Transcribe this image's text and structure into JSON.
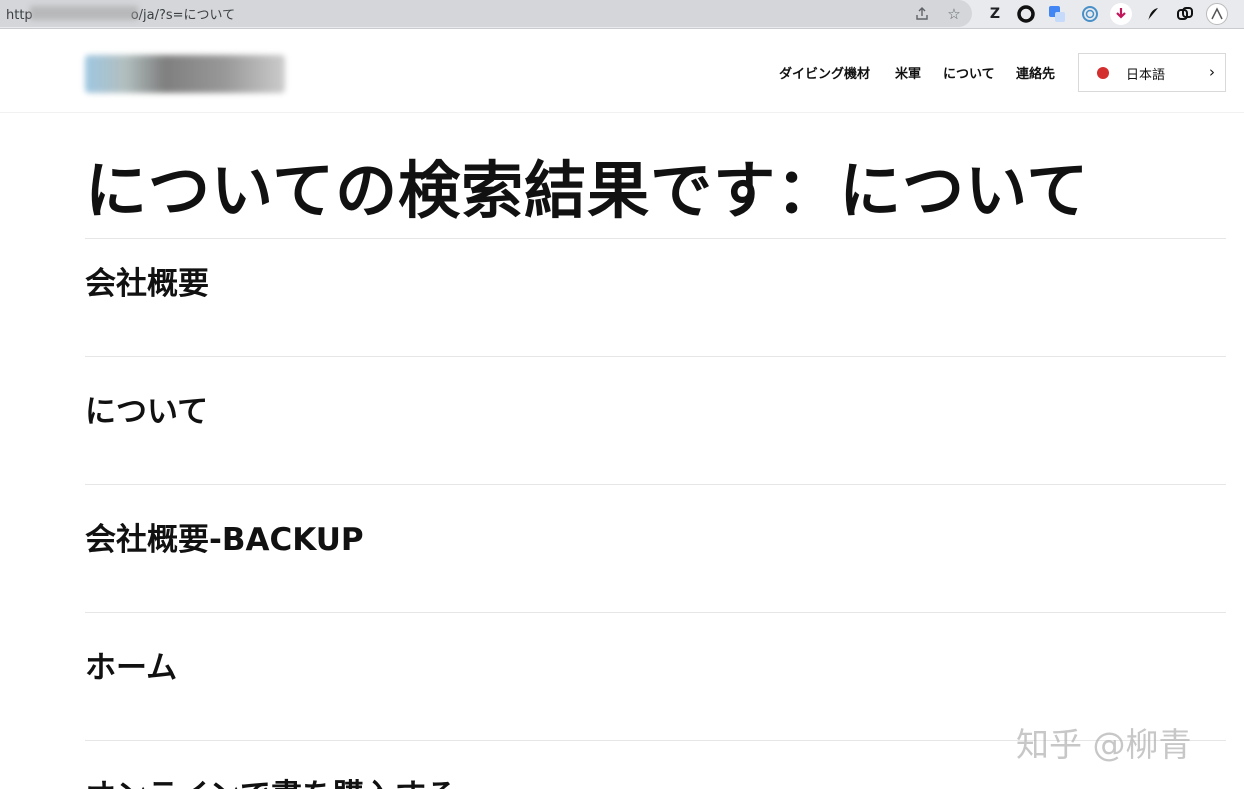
{
  "browser": {
    "url_prefix": "http",
    "url_suffix": "o/ja/?s=について",
    "extensions": [
      "Z",
      "O",
      "G",
      "◎",
      "◆",
      "✎",
      "⧉",
      "Λ"
    ]
  },
  "header": {
    "nav": [
      "ダイビング機材",
      "米軍",
      "について",
      "連絡先"
    ],
    "language": "日本語",
    "language_flag_color": "#d32f2f"
  },
  "main": {
    "title": "についての検索結果です：について",
    "results": [
      "会社概要",
      "について",
      "会社概要-BACKUP",
      "ホーム",
      "オンラインで書を購入する"
    ]
  },
  "watermark": "知乎 @柳青"
}
